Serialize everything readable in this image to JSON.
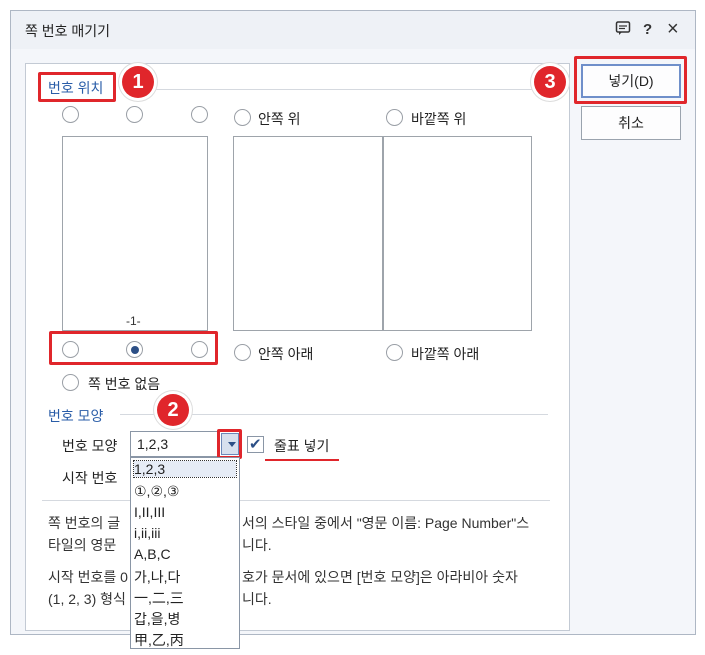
{
  "window": {
    "title": "쪽 번호 매기기",
    "icons": [
      "comment-icon",
      "help-icon",
      "close-icon"
    ],
    "help_glyph": "?",
    "close_glyph": "×"
  },
  "position": {
    "section_label": "번호 위치",
    "radio_labels": {
      "inner_top": "안쪽 위",
      "outer_top": "바깥쪽 위",
      "inner_bottom": "안쪽 아래",
      "outer_bottom": "바깥쪽 아래",
      "no_number": "쪽 번호 없음"
    },
    "preview_page_number": "-1-",
    "selected": "bottom-center"
  },
  "format": {
    "section_label": "번호 모양",
    "shape_label": "번호 모양",
    "shape_value": "1,2,3",
    "start_label": "시작 번호",
    "insert_mark_label": "줄표 넣기",
    "insert_mark_checked": true,
    "options": [
      "1,2,3",
      "①,②,③",
      "I,II,III",
      "i,ii,iii",
      "A,B,C",
      "가,나,다",
      "一,二,三",
      "갑,을,병",
      "甲,乙,丙"
    ]
  },
  "notes": {
    "line1a": "쪽 번호의 글",
    "line1b": "서의 스타일 중에서 \"영문 이름: Page Number\"스",
    "line2a": "타일의 영문",
    "line2b": "니다.",
    "line3a": "시작 번호를 0",
    "line3b": "호가 문서에 있으면 [번호 모양]은 아라비아 숫자",
    "line4a": "(1, 2, 3) 형식",
    "line4b": "니다."
  },
  "buttons": {
    "insert": "넣기(D)",
    "cancel": "취소"
  },
  "annotations": [
    "1",
    "2",
    "3"
  ],
  "colors": {
    "accent": "#2a5da8",
    "annotation_red": "#e0262b",
    "radio_selected": "#2c4f86"
  }
}
